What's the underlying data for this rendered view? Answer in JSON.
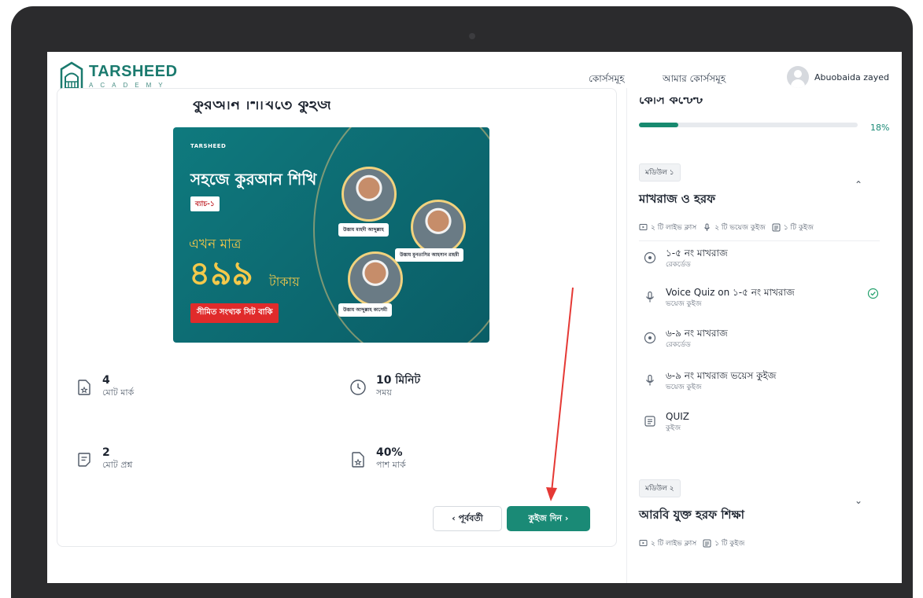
{
  "brand": {
    "title": "TARSHEED",
    "subtitle": "ACADEMY"
  },
  "nav": {
    "courses": "কোর্সসমূহ",
    "my_courses": "আমার কোর্সসমূহ",
    "user_name": "Abuobaida zayed"
  },
  "quiz": {
    "title": "কুরআন শিখিতে কুইজ"
  },
  "banner": {
    "brand": "TARSHEED",
    "headline": "সহজে কুরআন শিখি",
    "batch": "ব্যাচ-১",
    "now_only": "এখন মাত্র",
    "price": "৪৯৯",
    "currency": "টাকায়",
    "cta": "সীমিত সংখ্যক সিট বাকি",
    "teacher1": "উস্তায মাহদী আব্দুল্লাহ",
    "teacher2": "উস্তায মুনতাসির আহসান রাহমী",
    "teacher3": "উস্তায আব্দুল্লাহ কাসেমী"
  },
  "stats": {
    "total_marks_value": "4",
    "total_marks_label": "মোট মার্ক",
    "time_value": "10 মিনিট",
    "time_label": "সময়",
    "total_questions_value": "2",
    "total_questions_label": "মোট প্রশ্ন",
    "pass_mark_value": "40%",
    "pass_mark_label": "পাশ মার্ক"
  },
  "buttons": {
    "prev": "‹ পূর্ববর্তী",
    "next": "কুইজ দিন ›"
  },
  "sidebar": {
    "title": "কোর্স কন্টেন্ট",
    "progress_percent": 18,
    "progress_label": "18%",
    "modules": [
      {
        "badge": "মডিউল ১",
        "title": "মাখরাজ ও হরফ",
        "meta": [
          "২ টি লাইভ ক্লাস",
          "২ টি ভয়েজ কুইজ",
          "১ টি কুইজ"
        ],
        "lessons": [
          {
            "title": "১-৫ নং মাখরাজ",
            "sub": "রেকর্ডেড"
          },
          {
            "title": "Voice Quiz on ১-৫ নং মাখরাজ",
            "sub": "ভয়েজ কুইজ"
          },
          {
            "title": "৬-৯ নং মাখরাজ",
            "sub": "রেকর্ডেড"
          },
          {
            "title": "৬-৯ নং মাখরাজ ভয়েস কুইজ",
            "sub": "ভয়েজ কুইজ"
          },
          {
            "title": "QUIZ",
            "sub": "কুইজ"
          }
        ]
      },
      {
        "badge": "মডিউল ২",
        "title": "আরবি যুক্ত হরফ শিক্ষা",
        "meta": [
          "২ টি লাইভ ক্লাস",
          "১ টি কুইজ"
        ]
      }
    ]
  },
  "colors": {
    "accent": "#1a8a76",
    "brand": "#1a7a6e",
    "annotation_arrow": "#e53935"
  }
}
